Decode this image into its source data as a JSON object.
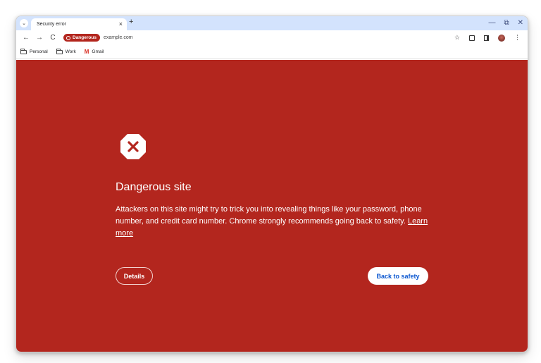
{
  "colors": {
    "danger_background": "#b3261e",
    "tabstrip": "#d3e3fd",
    "primary_button_text": "#0b57d0"
  },
  "tabstrip": {
    "search_icon": "chevron-down-icon",
    "tab_title": "Security error",
    "close_glyph": "×",
    "new_tab_glyph": "+",
    "minimize_glyph": "—",
    "restore_glyph": "⧉",
    "close_window_glyph": "✕"
  },
  "toolbar": {
    "back_glyph": "←",
    "forward_glyph": "→",
    "reload_glyph": "C",
    "chip_label": "Dangerous",
    "url": "example.com",
    "bookmark_star_glyph": "☆"
  },
  "bookmarks": [
    {
      "label": "Personal",
      "icon": "folder-icon"
    },
    {
      "label": "Work",
      "icon": "folder-icon"
    },
    {
      "label": "Gmail",
      "icon": "gmail-icon"
    }
  ],
  "interstitial": {
    "icon": "danger-octagon-icon",
    "title": "Dangerous site",
    "body": "Attackers on this site might try to trick you into revealing things like your password, phone number, and credit card number. Chrome strongly recommends going back to safety.",
    "learn_more": "Learn more",
    "details_button": "Details",
    "back_to_safety_button": "Back to safety"
  }
}
